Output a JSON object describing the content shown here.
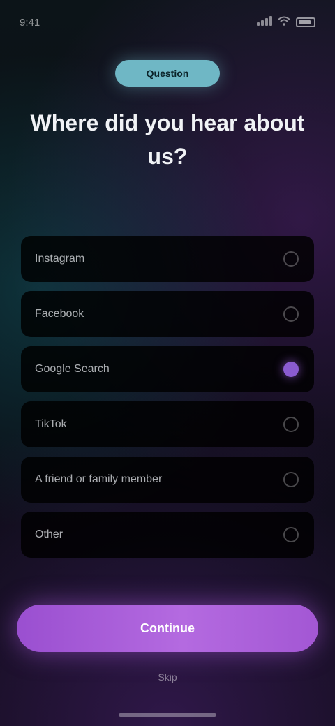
{
  "status_bar": {
    "time": "9:41",
    "signal_icon": "signal-icon",
    "wifi_icon": "wifi-icon",
    "battery_icon": "battery-icon"
  },
  "step_pill": {
    "label": "Question"
  },
  "title": "Where did you hear about us?",
  "options": [
    {
      "label": "Instagram",
      "selected": false
    },
    {
      "label": "Facebook",
      "selected": false
    },
    {
      "label": "Google Search",
      "selected": true
    },
    {
      "label": "TikTok",
      "selected": false
    },
    {
      "label": "A friend or family member",
      "selected": false
    },
    {
      "label": "Other",
      "selected": false
    }
  ],
  "continue_button": {
    "label": "Continue"
  },
  "footer_link": {
    "label": "Skip"
  },
  "colors": {
    "accent_teal": "#6fb7c5",
    "accent_purple": "#a357d4",
    "background": "#0b0f14"
  }
}
